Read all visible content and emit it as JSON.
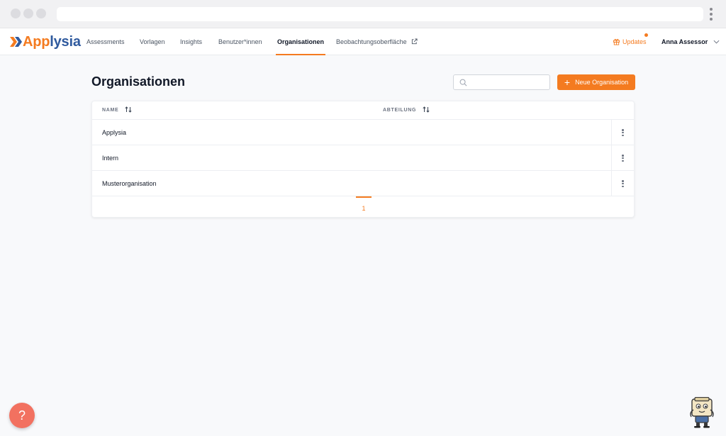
{
  "brand": {
    "name_part1": "App",
    "name_part2": "lysia",
    "orange": "#f47b20",
    "blue": "#2f5a9e"
  },
  "nav": {
    "items": [
      {
        "label": "Assessments",
        "active": false
      },
      {
        "label": "Vorlagen",
        "active": false
      },
      {
        "label": "Insights",
        "active": false
      },
      {
        "label": "Benutzer*innen",
        "active": false
      },
      {
        "label": "Organisationen",
        "active": true
      },
      {
        "label": "Beobachtungsoberfläche",
        "active": false,
        "icon": "external-link-icon"
      }
    ],
    "updates_label": "Updates",
    "user_name": "Anna Assessor"
  },
  "page": {
    "title": "Organisationen",
    "search_value": "",
    "new_button_label": "Neue Organisation"
  },
  "table": {
    "columns": [
      "NAME",
      "ABTEILUNG"
    ],
    "rows": [
      {
        "name": "Applysia",
        "department": ""
      },
      {
        "name": "Intern",
        "department": ""
      },
      {
        "name": "Musterorganisation",
        "department": ""
      }
    ]
  },
  "pagination": {
    "current_page": "1"
  },
  "help": {
    "label": "?"
  }
}
